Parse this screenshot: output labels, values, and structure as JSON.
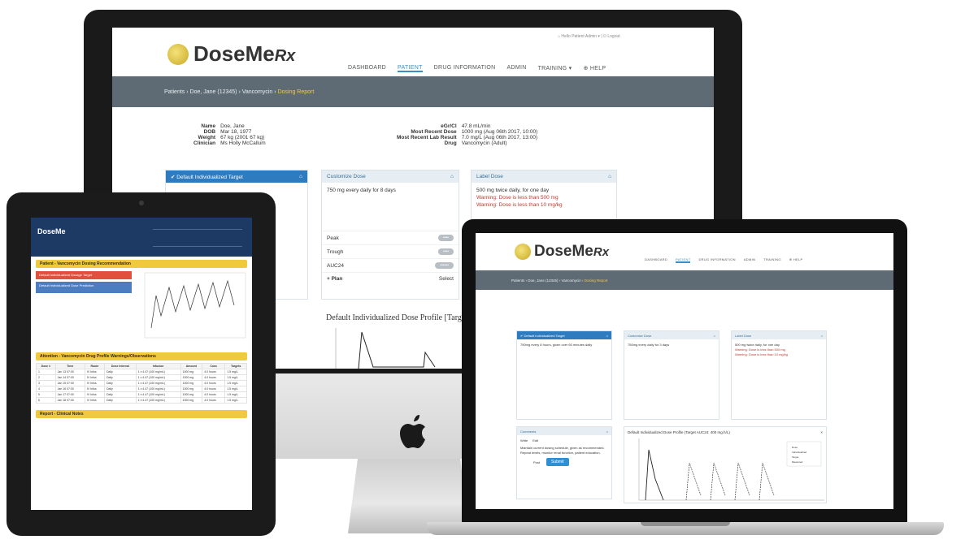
{
  "brand": {
    "name": "DoseMe",
    "suffix": "Rx",
    "accent": "#3a8fc8",
    "header_color": "#5f6b74",
    "highlight": "#f2c84b",
    "warning": "#c0392b"
  },
  "desktop": {
    "nav": [
      "DASHBOARD",
      "PATIENT",
      "DRUG INFORMATION",
      "ADMIN",
      "TRAINING ▾",
      "⊕ HELP"
    ],
    "userbar": "⌂ Hello Patient Admin ▾  |  ⏻ Logout",
    "crumbs": {
      "path": "Patients › Doe, Jane (12345) › Vancomycin ›",
      "current": "Dosing Report"
    },
    "patient": {
      "left": [
        {
          "label": "Name",
          "value": "Doe, Jane"
        },
        {
          "label": "DOB",
          "value": "Mar 18, 1977"
        },
        {
          "label": "Weight",
          "value": "67 kg (2001 67 kg)"
        },
        {
          "label": "Clinician",
          "value": "Ms Holly McCallum"
        }
      ],
      "right": [
        {
          "label": "eGr/Cl",
          "value": "47.8 mL/min"
        },
        {
          "label": "Most Recent Dose",
          "value": "1000 mg (Aug 06th 2017, 10:00)"
        },
        {
          "label": "Most Recent Lab Result",
          "value": "7.0 mg/L (Aug 06th 2017, 13:00)"
        },
        {
          "label": "Drug",
          "value": "Vancomycin (Adult)"
        }
      ]
    },
    "cards": {
      "target": {
        "title": "✔ Default Individualized Target"
      },
      "customize": {
        "title": "Customize Dose",
        "text": "750 mg every daily for 8 days"
      },
      "label": {
        "title": "Label Dose",
        "text": "500 mg twice daily, for one day",
        "warn1": "Warning: Dose is less than 500 mg",
        "warn2": "Warning: Dose is less than 10 mg/kg"
      }
    },
    "rows": [
      "Peak",
      "Trough",
      "AUC24"
    ],
    "plan_label": "+ Plan",
    "select_label": "Select",
    "profile_title": "Default Individualized Dose Profile [Targ"
  },
  "tablet": {
    "logo": "DoseMe",
    "sections": [
      "Patient - Vancomycin Dosing Recommendation",
      "Attention - Vancomycin Drug Profile Warnings/Observations",
      "Report - Clinical Notes"
    ],
    "red_banner": "Default Individualized Dosage Target",
    "blue_banner": "Default Individualized Dose Prediction",
    "table_headers": [
      "Dose #",
      "Time",
      "Route",
      "Dose Interval",
      "Infusion",
      "Amount",
      "Conc",
      "Targets"
    ],
    "table_rows": [
      [
        "1",
        "Jan 13 07:00",
        "IV Infus",
        "Daily",
        "1 x 4.47 (100 mg/mL)",
        "1000 mg",
        "4.0 hours",
        "1.5 mg/L"
      ],
      [
        "2",
        "Jan 14 07:00",
        "IV Infus",
        "Daily",
        "1 x 4.47 (100 mg/mL)",
        "1000 mg",
        "4.0 hours",
        "1.5 mg/L"
      ],
      [
        "3",
        "Jan 15 07:00",
        "IV Infus",
        "Daily",
        "1 x 4.47 (100 mg/mL)",
        "1000 mg",
        "4.0 hours",
        "1.5 mg/L"
      ],
      [
        "4",
        "Jan 16 07:00",
        "IV Infus",
        "Daily",
        "1 x 4.47 (100 mg/mL)",
        "1000 mg",
        "4.0 hours",
        "1.5 mg/L"
      ],
      [
        "5",
        "Jan 17 07:00",
        "IV Infus",
        "Daily",
        "1 x 4.47 (100 mg/mL)",
        "1000 mg",
        "4.0 hours",
        "1.5 mg/L"
      ],
      [
        "6",
        "Jan 18 07:00",
        "IV Infus",
        "Daily",
        "1 x 4.47 (100 mg/mL)",
        "1000 mg",
        "4.0 hours",
        "1.5 mg/L"
      ]
    ]
  },
  "laptop": {
    "nav": [
      "DASHBOARD",
      "PATIENT",
      "DRUG INFORMATION",
      "ADMIN",
      "TRAINING",
      "⊕ HELP"
    ],
    "crumbs": {
      "path": "Patients › Doe, Jane (12345) › Vancomycin ›",
      "current": "Dosing Report"
    },
    "target_title": "✔ Default Individualized Target",
    "target_text": "750mg every 8 hours, given over 60 minutes daily",
    "customize_title": "Customize Dose",
    "customize_text": "750mg every daily for 3 days",
    "label_title": "Label Dose",
    "label_text": "500 mg twice daily, for one day",
    "warn1": "Warning: Dose is less than 500 mg",
    "warn2": "Warning: Dose is less than 10 mg/kg",
    "comments_title": "Comments",
    "comment_tabs": [
      "Write",
      "Edit"
    ],
    "comment_text": "Maintain current dosing schedule, given as recommended. Repeat levels, monitor renal function, patient education.",
    "post_label": "Post",
    "submit_label": "Submit",
    "profile_title": "Default Individualized Dose Profile (Target AUC24: 400 mg.h/L)",
    "legend": [
      "Dose",
      "Individualized",
      "Target",
      "Measured"
    ]
  }
}
